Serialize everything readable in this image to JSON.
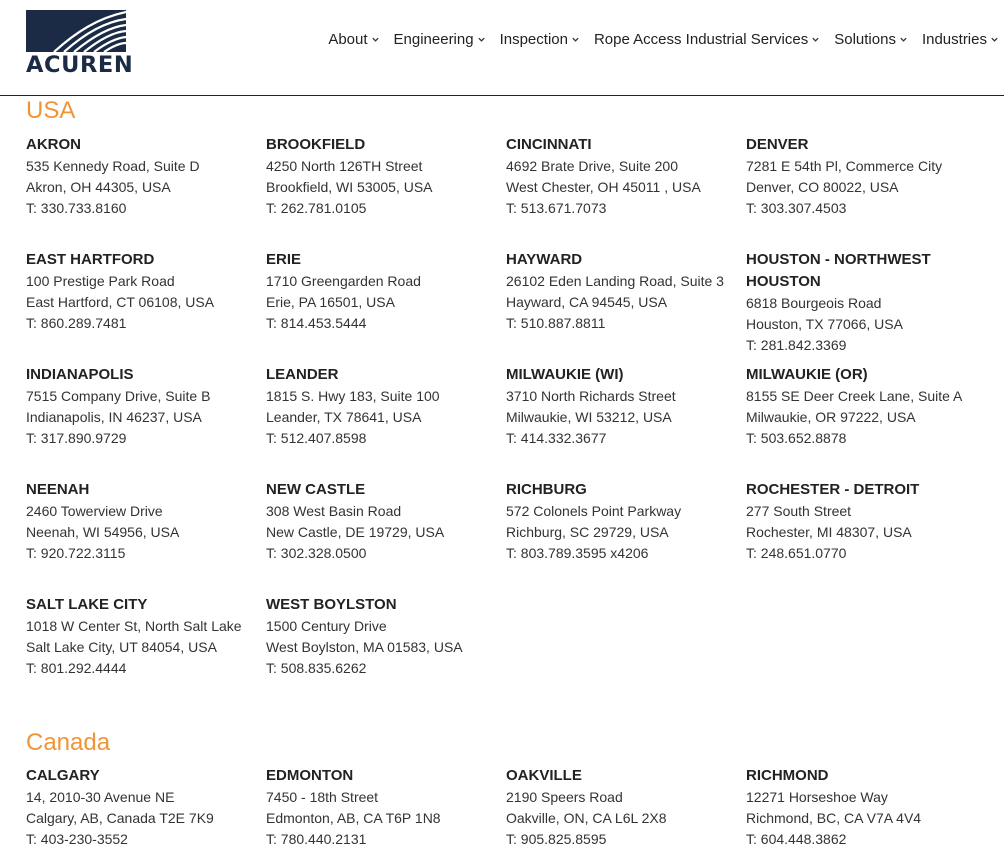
{
  "brand": {
    "name": "ACUREN",
    "primary_color": "#1b2a45",
    "accent_color": "#f09537"
  },
  "nav": [
    {
      "label": "About"
    },
    {
      "label": "Engineering"
    },
    {
      "label": "Inspection"
    },
    {
      "label": "Rope Access Industrial Services"
    },
    {
      "label": "Solutions"
    },
    {
      "label": "Industries"
    }
  ],
  "regions": [
    {
      "name": "USA",
      "offices": [
        {
          "name": "AKRON",
          "lines": [
            "535 Kennedy Road, Suite D",
            "Akron, OH 44305, USA",
            "T: 330.733.8160"
          ]
        },
        {
          "name": "BROOKFIELD",
          "lines": [
            "4250 North 126TH Street",
            "Brookfield, WI 53005, USA",
            "T: 262.781.0105"
          ]
        },
        {
          "name": "CINCINNATI",
          "lines": [
            "4692 Brate Drive, Suite 200",
            "West Chester, OH 45011 , USA",
            "T: 513.671.7073"
          ]
        },
        {
          "name": "DENVER",
          "lines": [
            "7281 E 54th Pl, Commerce City",
            "Denver, CO 80022, USA",
            "T: 303.307.4503"
          ]
        },
        {
          "name": "EAST HARTFORD",
          "lines": [
            "100 Prestige Park Road",
            "East Hartford, CT 06108, USA",
            "T: 860.289.7481"
          ]
        },
        {
          "name": "ERIE",
          "lines": [
            "1710 Greengarden Road",
            "Erie, PA 16501, USA",
            "T: 814.453.5444"
          ]
        },
        {
          "name": "HAYWARD",
          "lines": [
            "26102 Eden Landing Road, Suite 3",
            "Hayward, CA 94545, USA",
            "T: 510.887.8811"
          ]
        },
        {
          "name": "HOUSTON - NORTHWEST HOUSTON",
          "lines": [
            "6818 Bourgeois Road",
            "Houston, TX 77066, USA",
            "T: 281.842.3369"
          ]
        },
        {
          "name": "INDIANAPOLIS",
          "lines": [
            "7515 Company Drive, Suite B",
            "Indianapolis, IN 46237, USA",
            "T: 317.890.9729"
          ]
        },
        {
          "name": "LEANDER",
          "lines": [
            "1815 S. Hwy 183, Suite 100",
            "Leander, TX 78641, USA",
            "T: 512.407.8598"
          ]
        },
        {
          "name": "MILWAUKIE (WI)",
          "lines": [
            "3710 North Richards Street",
            "Milwaukie, WI 53212, USA",
            "T: 414.332.3677"
          ]
        },
        {
          "name": "MILWAUKIE (OR)",
          "lines": [
            "8155 SE Deer Creek Lane, Suite A",
            "Milwaukie, OR 97222, USA",
            "T: 503.652.8878"
          ]
        },
        {
          "name": "NEENAH",
          "lines": [
            "2460 Towerview Drive",
            "Neenah, WI 54956, USA",
            "T: 920.722.3115"
          ]
        },
        {
          "name": "NEW CASTLE",
          "lines": [
            "308 West Basin Road",
            "New Castle, DE 19729, USA",
            "T: 302.328.0500"
          ]
        },
        {
          "name": "RICHBURG",
          "lines": [
            "572 Colonels Point Parkway",
            "Richburg, SC 29729, USA",
            "T: 803.789.3595 x4206"
          ]
        },
        {
          "name": "ROCHESTER - DETROIT",
          "lines": [
            "277 South Street",
            "Rochester, MI 48307, USA",
            "T: 248.651.0770"
          ]
        },
        {
          "name": "SALT LAKE CITY",
          "lines": [
            "1018 W Center St, North Salt Lake",
            "Salt Lake City, UT 84054, USA",
            "T: 801.292.4444"
          ]
        },
        {
          "name": "WEST BOYLSTON",
          "lines": [
            "1500 Century Drive",
            "West Boylston, MA 01583, USA",
            "T: 508.835.6262"
          ]
        }
      ]
    },
    {
      "name": "Canada",
      "offices": [
        {
          "name": "CALGARY",
          "lines": [
            "14, 2010-30 Avenue NE",
            "Calgary, AB, Canada T2E 7K9",
            "T: 403-230-3552"
          ]
        },
        {
          "name": "EDMONTON",
          "lines": [
            "7450 - 18th Street",
            "Edmonton, AB, CA T6P 1N8",
            "T: 780.440.2131"
          ]
        },
        {
          "name": "OAKVILLE",
          "lines": [
            "2190 Speers Road",
            "Oakville, ON, CA L6L 2X8",
            "T: 905.825.8595"
          ]
        },
        {
          "name": "RICHMOND",
          "lines": [
            "12271 Horseshoe Way",
            "Richmond, BC, CA V7A 4V4",
            "T: 604.448.3862"
          ]
        }
      ]
    }
  ]
}
